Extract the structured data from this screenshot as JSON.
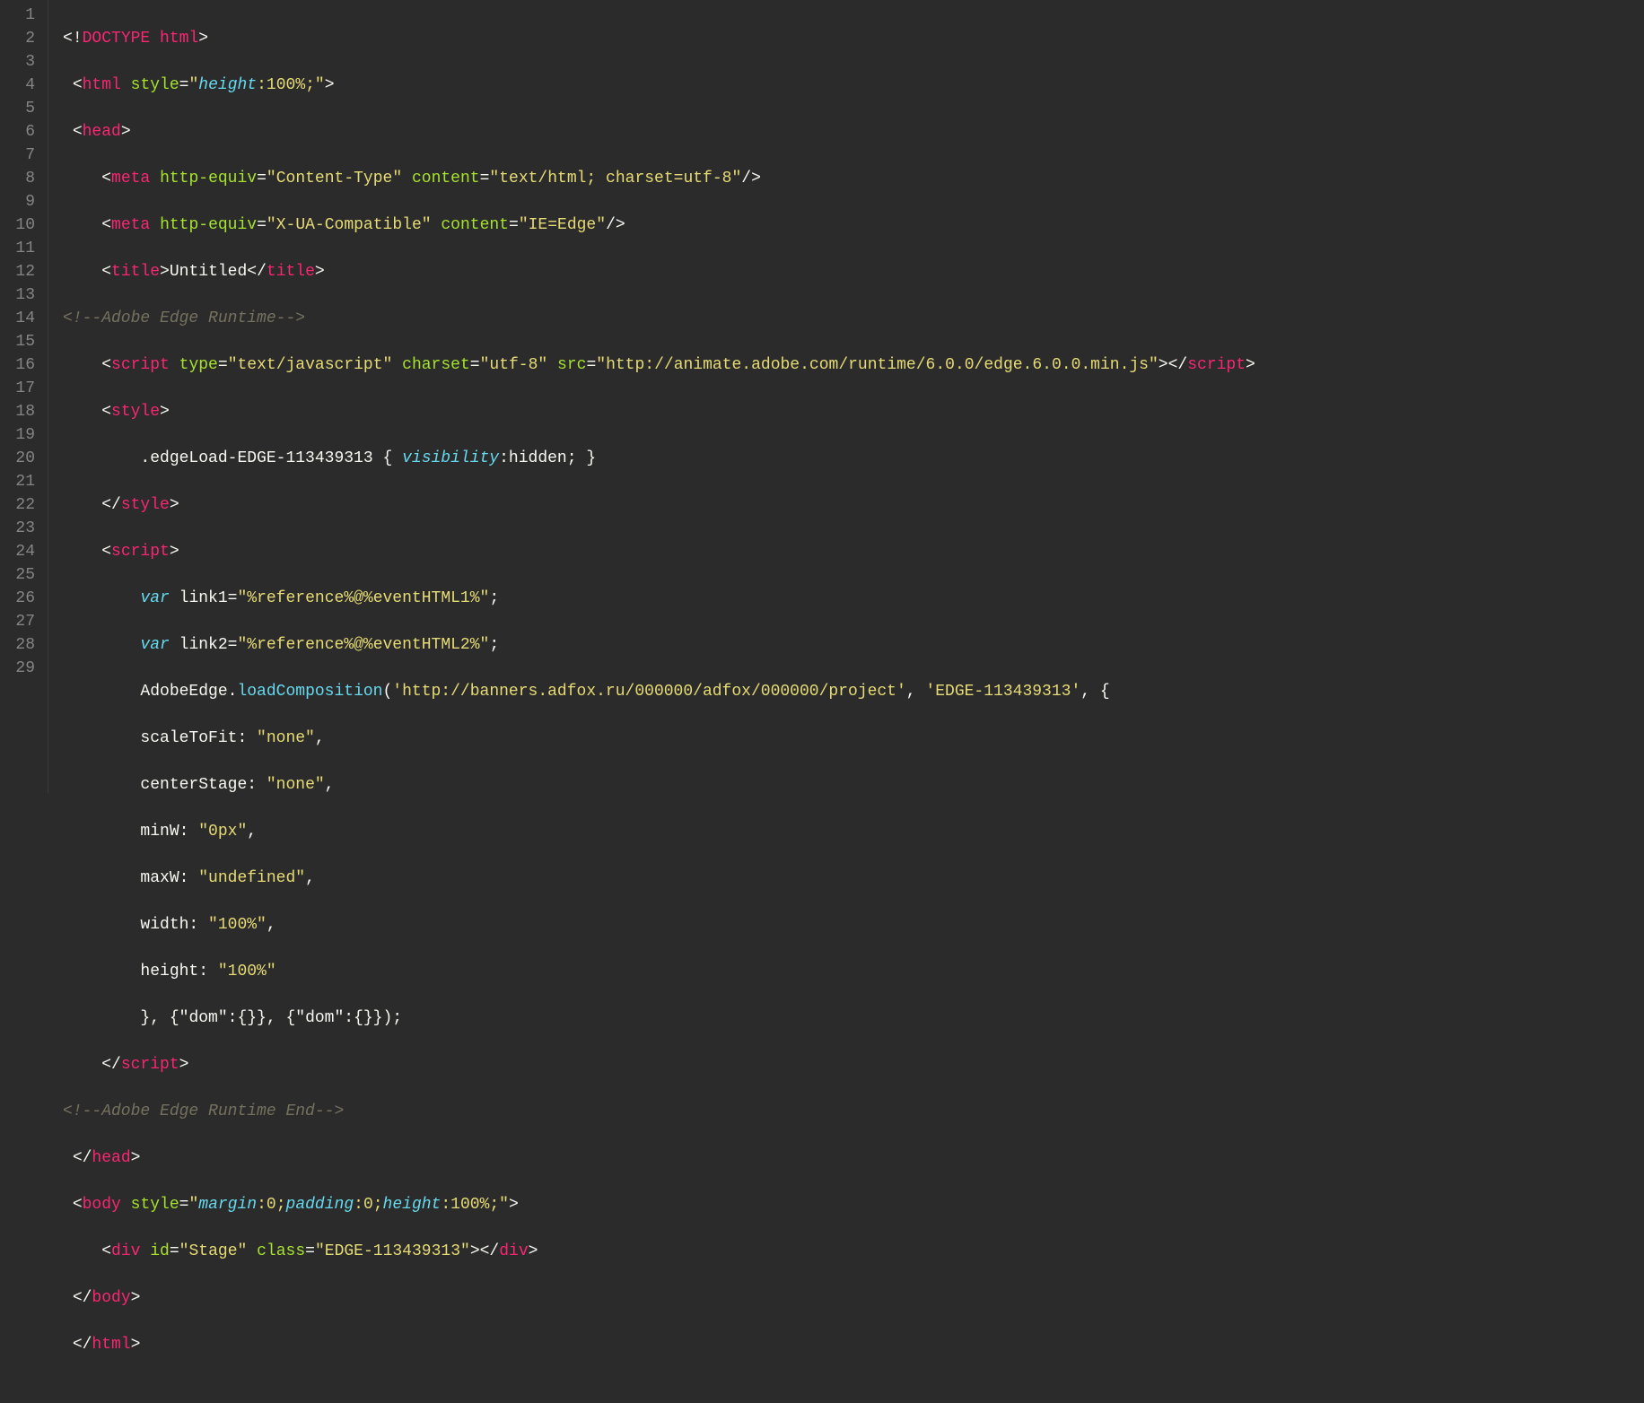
{
  "gutter": {
    "lines": [
      "1",
      "2",
      "3",
      "4",
      "5",
      "6",
      "7",
      "8",
      "9",
      "10",
      "11",
      "12",
      "13",
      "14",
      "15",
      "16",
      "17",
      "18",
      "19",
      "20",
      "21",
      "22",
      "23",
      "24",
      "25",
      "26",
      "27",
      "28",
      "29"
    ]
  },
  "t": {
    "lt": "<",
    "gt": ">",
    "lts": "</",
    "sgt": "/>",
    "bang": "!",
    "doctype": "DOCTYPE html",
    "html": "html",
    "head": "head",
    "meta": "meta",
    "title": "title",
    "script": "script",
    "style_tag": "style",
    "body": "body",
    "div": "div",
    "sp": " ",
    "eq": "=",
    "q": "\"",
    "semi": ";",
    "ob": "{",
    "cb": "}",
    "op": "(",
    "cp": ")",
    "comma": ",",
    "colon": ":",
    "dot": "."
  },
  "attrs": {
    "style": "style",
    "http_equiv": "http-equiv",
    "content": "content",
    "type": "type",
    "charset": "charset",
    "src": "src",
    "id": "id",
    "class": "class"
  },
  "vals": {
    "html_style_height": "height",
    "html_style_rest": ":100%;",
    "content_type": "Content-Type",
    "content_type_val": "text/html; charset=utf-8",
    "xua": "X-UA-Compatible",
    "xua_val": "IE=Edge",
    "title_text": "Untitled",
    "script_type": "text/javascript",
    "script_charset": "utf-8",
    "script_src": "http://animate.adobe.com/runtime/6.0.0/edge.6.0.0.min.js",
    "css_selector": ".edgeLoad-EDGE-113439313 ",
    "css_prop": "visibility",
    "css_val": ":hidden; ",
    "var": "var",
    "link1": "link1",
    "link2": "link2",
    "link1_val": "%reference%@%eventHTML1%",
    "link2_val": "%reference%@%eventHTML2%",
    "adobe_edge": "AdobeEdge",
    "load_comp": "loadComposition",
    "comp_url": "'http://banners.adfox.ru/000000/adfox/000000/project'",
    "comp_id": "'EDGE-113439313'",
    "scaleToFit_k": "scaleToFit: ",
    "scaleToFit_v": "\"none\"",
    "centerStage_k": "centerStage: ",
    "centerStage_v": "\"none\"",
    "minW_k": "minW: ",
    "minW_v": "\"0px\"",
    "maxW_k": "maxW: ",
    "maxW_v": "\"undefined\"",
    "width_k": "width: ",
    "width_v": "\"100%\"",
    "height_k": "height: ",
    "height_v": "\"100%\"",
    "dom_tail": ", {\"dom\":{}}, {\"dom\":{}});",
    "cmt_runtime": "<!--Adobe Edge Runtime-->",
    "cmt_runtime_end": "<!--Adobe Edge Runtime End-->",
    "body_style_m": "margin",
    "body_style_p": "padding",
    "body_style_h": "height",
    "body_style_mv": ":0;",
    "body_style_pv": ":0;",
    "body_style_hv": ":100%;",
    "stage_id": "Stage",
    "stage_class": "EDGE-113439313"
  }
}
